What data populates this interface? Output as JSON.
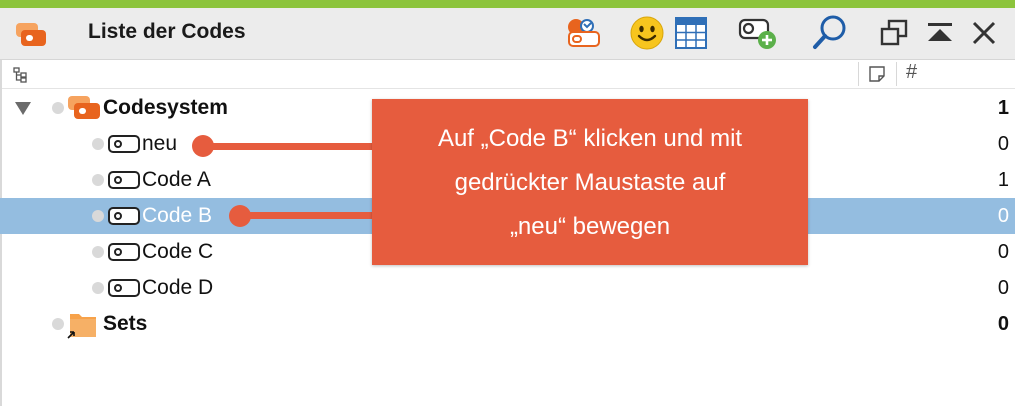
{
  "window": {
    "title": "Liste der Codes"
  },
  "colors": {
    "accent_top": "#8cc43c",
    "selection": "#94bde0",
    "callout": "#e65c3e",
    "code_orange": "#e8641e"
  },
  "toolbar": {
    "icons": [
      "code-activation-icon",
      "emoticon-icon",
      "code-matrix-icon",
      "new-code-icon",
      "search-icon",
      "undock-window-icon",
      "collapse-icon",
      "close-icon"
    ],
    "column_hash": "#"
  },
  "tree": {
    "root": {
      "label": "Codesystem",
      "count": "1"
    },
    "codes": [
      {
        "label": "neu",
        "count": "0",
        "selected": false
      },
      {
        "label": "Code A",
        "count": "1",
        "selected": false
      },
      {
        "label": "Code B",
        "count": "0",
        "selected": true
      },
      {
        "label": "Code C",
        "count": "0",
        "selected": false
      },
      {
        "label": "Code D",
        "count": "0",
        "selected": false
      }
    ],
    "sets": {
      "label": "Sets",
      "count": "0"
    }
  },
  "callout": {
    "text": "Auf „Code B“ klicken und mit\ngedrückter Maustaste auf\n„neu“ bewegen"
  }
}
